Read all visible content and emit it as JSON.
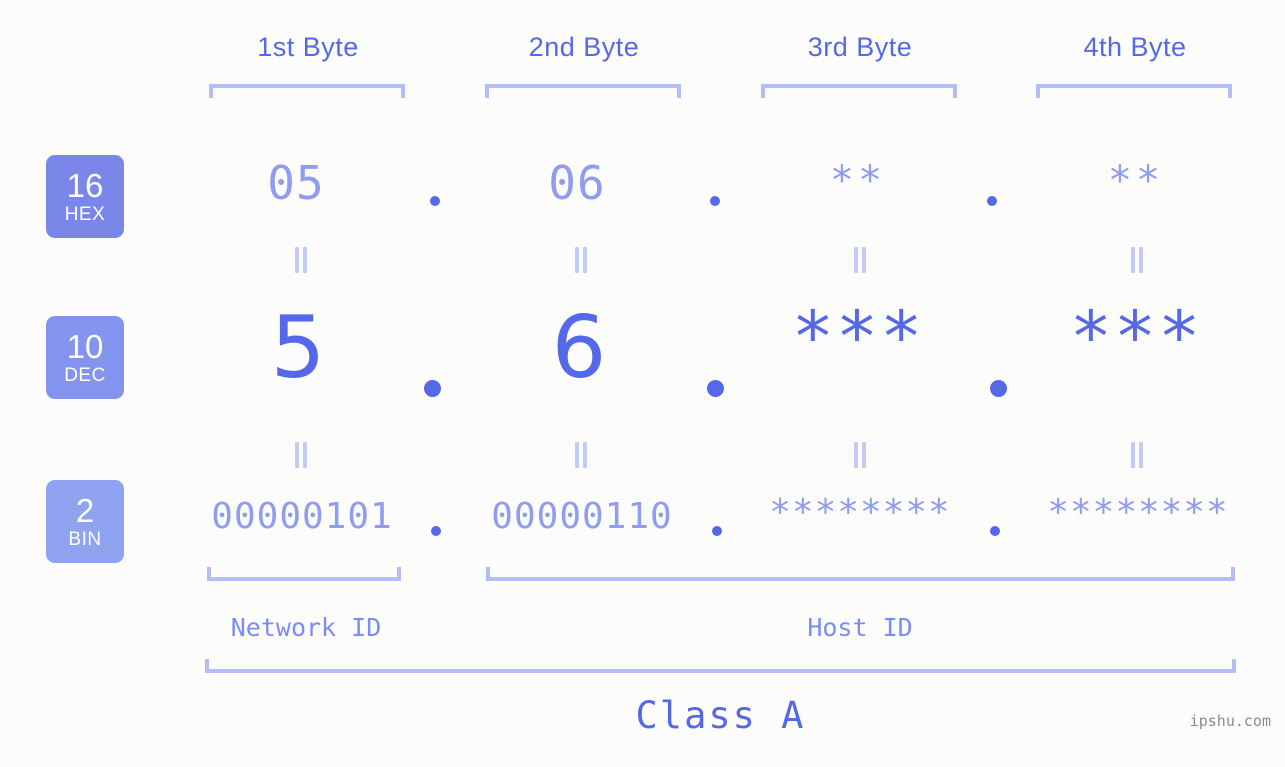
{
  "background_color": "#fcfdfa",
  "accent_color": "#5468e8",
  "muted_color": "#8f9cf0",
  "bracket_color": "#b3bdf7",
  "byte_headers": [
    {
      "label": "1st Byte"
    },
    {
      "label": "2nd Byte"
    },
    {
      "label": "3rd Byte"
    },
    {
      "label": "4th Byte"
    }
  ],
  "rows": [
    {
      "badge_number": "16",
      "badge_name": "HEX",
      "badge_color": "#7a86e8",
      "values": [
        "05",
        "06",
        "**",
        "**"
      ]
    },
    {
      "badge_number": "10",
      "badge_name": "DEC",
      "badge_color": "#8494ee",
      "values": [
        "5",
        "6",
        "***",
        "***"
      ]
    },
    {
      "badge_number": "2",
      "badge_name": "BIN",
      "badge_color": "#8fa3f0",
      "values": [
        "00000101",
        "00000110",
        "********",
        "********"
      ]
    }
  ],
  "separator": ".",
  "equals_symbol": "=",
  "segments": {
    "network_id": "Network ID",
    "host_id": "Host ID"
  },
  "class_label": "Class A",
  "watermark": "ipshu.com",
  "chart_data": {
    "type": "table",
    "title": "IP address byte breakdown - Class A",
    "columns": [
      "1st Byte",
      "2nd Byte",
      "3rd Byte",
      "4th Byte"
    ],
    "rows": [
      {
        "base": 16,
        "name": "HEX",
        "values": [
          "05",
          "06",
          "**",
          "**"
        ]
      },
      {
        "base": 10,
        "name": "DEC",
        "values": [
          "5",
          "6",
          "***",
          "***"
        ]
      },
      {
        "base": 2,
        "name": "BIN",
        "values": [
          "00000101",
          "00000110",
          "********",
          "********"
        ]
      }
    ],
    "network_id_bytes": [
      1
    ],
    "host_id_bytes": [
      2,
      3,
      4
    ],
    "ip_class": "Class A"
  }
}
